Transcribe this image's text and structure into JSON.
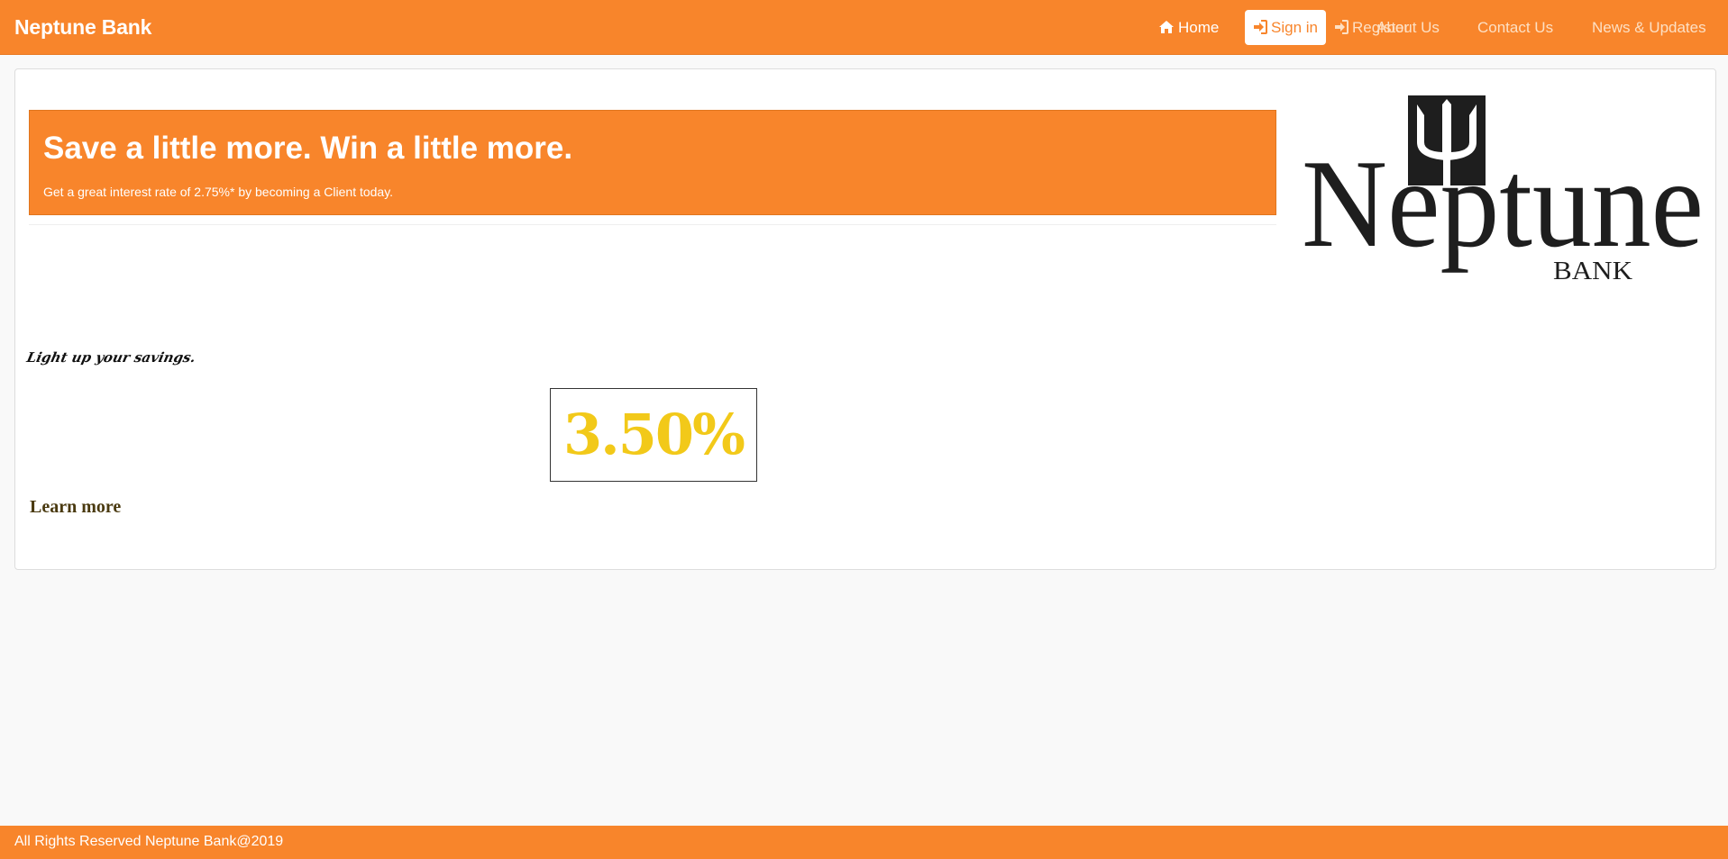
{
  "brand": "Neptune Bank",
  "nav": {
    "home": "Home",
    "sign_in": "Sign in",
    "register": "Register",
    "about": "About Us",
    "contact": "Contact Us",
    "news": "News & Updates"
  },
  "hero": {
    "title": "Save a little more. Win a little more.",
    "subtitle": "Get a great interest rate of 2.75%* by becoming a Client today."
  },
  "logo": {
    "name": "Neptune",
    "sub": "BANK"
  },
  "promo": {
    "tagline": "Light up your savings.",
    "rate": "3.50%",
    "learn_more": "Learn more"
  },
  "footer": {
    "text": "All Rights Reserved Neptune Bank@2019"
  },
  "colors": {
    "brand_orange": "#f8852b",
    "rate_yellow": "#f2c919"
  },
  "icons": {
    "home": "home-icon",
    "sign_in": "sign-in-icon",
    "register": "sign-in-icon"
  }
}
